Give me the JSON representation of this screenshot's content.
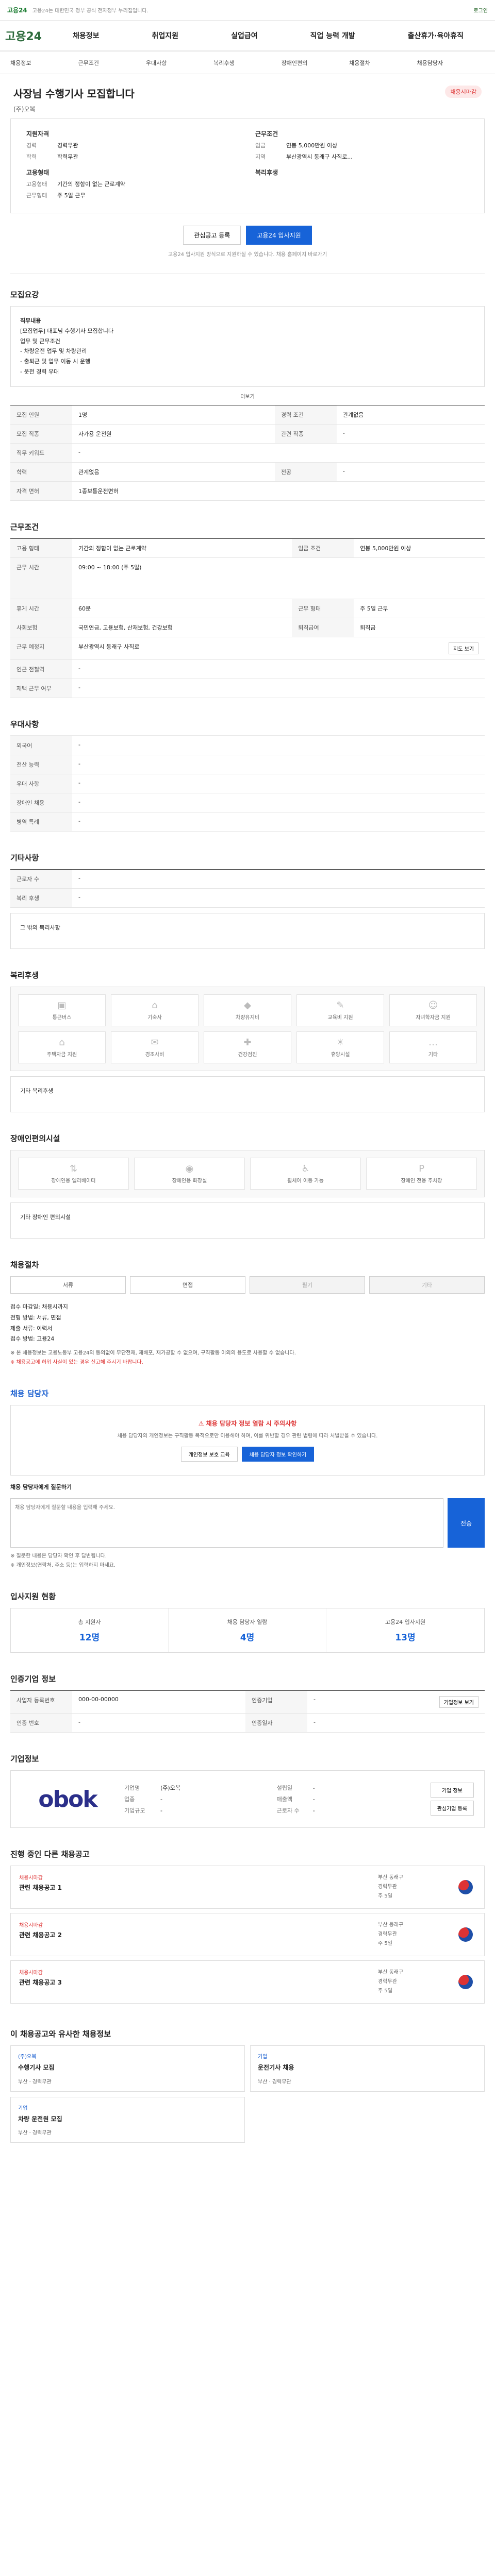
{
  "topbar": {
    "logo": "고용24",
    "notice": "고용24는 대한민국 정부 공식 전자정부 누리집입니다.",
    "right": "로그인"
  },
  "nav": {
    "brand": "고용24",
    "menu": [
      "채용정보",
      "취업지원",
      "실업급여",
      "직업 능력 개발",
      "출산휴가·육아휴직"
    ]
  },
  "subnav": [
    "채용정보",
    "근무조건",
    "우대사항",
    "복리후생",
    "장애인편의",
    "채용절차",
    "채용담당자"
  ],
  "posting": {
    "title": "사장님 수행기사 모집합니다",
    "badge": "채용시마감",
    "company": "(주)오복",
    "left_head": "지원자격",
    "right_head": "근무조건",
    "left_rows": [
      {
        "k": "경력",
        "v": "경력무관"
      },
      {
        "k": "학력",
        "v": "학력무관"
      }
    ],
    "right_rows": [
      {
        "k": "임금",
        "v": "연봉 5,000만원 이상"
      },
      {
        "k": "지역",
        "v": "부산광역시 동래구 사직로..."
      }
    ],
    "left_head2": "고용형태",
    "right_head2": "복리후생",
    "left_rows2": [
      {
        "k": "고용형태",
        "v": "기간의 정함이 없는 근로계약"
      },
      {
        "k": "근무형태",
        "v": "주 5일 근무"
      }
    ],
    "btn_scrap": "관심공고 등록",
    "btn_apply": "고용24 입사지원",
    "note": "고용24 입사지원 방식으로 지원하실 수 있습니다. 채용 홈페이지 바로가기"
  },
  "sections": {
    "recruit": "모집요강",
    "work": "근무조건",
    "pref": "우대사항",
    "etc": "기타사항",
    "welfare": "복리후생",
    "disabled": "장애인편의시설",
    "process": "채용절차",
    "contact": "채용 담당자",
    "stats": "입사지원 현황",
    "gov_info": "인증기업 정보",
    "company_info": "기업정보",
    "jobs": "진행 중인 다른 채용공고",
    "related": "이 채용공고와 유사한 채용정보"
  },
  "recruit": {
    "box_title": "직무내용",
    "box_lines": [
      "[모집업무] 대표님 수행기사 모집합니다",
      "업무 및 근무조건",
      "- 차량운전 업무 및 차량관리",
      "- 출퇴근 및 업무 이동 시 운행",
      "- 운전 경력 우대"
    ],
    "rows": [
      {
        "k": "모집 인원",
        "v": "1명",
        "k2": "경력 조건",
        "v2": "관계없음"
      },
      {
        "k": "모집 직종",
        "v": "자가용 운전원",
        "k2": "관련 직종",
        "v2": "-"
      },
      {
        "k": "직무 키워드",
        "v": "-",
        "k2": "",
        "v2": ""
      },
      {
        "k": "학력",
        "v": "관계없음",
        "k2": "전공",
        "v2": "-"
      },
      {
        "k": "자격 면허",
        "v": "1종보통운전면허",
        "k2": "",
        "v2": ""
      }
    ],
    "more": "더보기"
  },
  "work": {
    "rows": [
      {
        "k": "고용 형태",
        "v": "기간의 정함이 없는 근로계약",
        "k2": "임금 조건",
        "v2": "연봉 5,000만원 이상"
      },
      {
        "k": "근무 시간",
        "v": "09:00 ~ 18:00 (주 5일)",
        "k2": "",
        "v2": ""
      },
      {
        "k": "휴게 시간",
        "v": "60분",
        "k2": "근무 형태",
        "v2": "주 5일 근무"
      },
      {
        "k": "사회보험",
        "v": "국민연금, 고용보험, 산재보험, 건강보험",
        "k2": "퇴직급여",
        "v2": "퇴직금"
      },
      {
        "k": "근무 예정지",
        "v": "부산광역시 동래구 사직로",
        "k2": "",
        "v2": ""
      },
      {
        "k": "인근 전철역",
        "v": "-",
        "k2": "",
        "v2": ""
      },
      {
        "k": "재택 근무 여부",
        "v": "-",
        "k2": "",
        "v2": ""
      }
    ],
    "map_btn": "지도 보기"
  },
  "pref": {
    "rows": [
      {
        "k": "외국어",
        "v": "-"
      },
      {
        "k": "전산 능력",
        "v": "-"
      },
      {
        "k": "우대 사항",
        "v": "-"
      },
      {
        "k": "장애인 채용",
        "v": "-"
      },
      {
        "k": "병역 특례",
        "v": "-"
      }
    ]
  },
  "etc": {
    "rows": [
      {
        "k": "근로자 수",
        "v": "-"
      },
      {
        "k": "복리 후생",
        "v": "-"
      }
    ],
    "box": "그 밖의 복리사항"
  },
  "welfare": {
    "items": [
      "통근버스",
      "기숙사",
      "차량유지비",
      "교육비 지원",
      "자녀학자금 지원",
      "주택자금 지원",
      "경조사비",
      "건강검진",
      "휴양시설",
      "기타"
    ],
    "box": "기타 복리후생"
  },
  "disabled": {
    "items": [
      "장애인용 엘리베이터",
      "장애인용 화장실",
      "휠체어 이동 가능",
      "장애인 전용 주차장"
    ],
    "box": "기타 장애인 편의시설"
  },
  "process": {
    "tabs": [
      "서류",
      "면접",
      "필기",
      "기타"
    ],
    "lines": [
      "접수 마감일: 채용시까지",
      "전형 방법: 서류, 면접",
      "제출 서류: 이력서",
      "접수 방법: 고용24"
    ],
    "warn1": "※ 본 채용정보는 고용노동부 고용24의 동의없이 무단전재, 재배포, 재가공할 수 없으며, 구직활동 이외의 용도로 사용할 수 없습니다.",
    "warn2": "※ 채용공고에 허위 사실이 있는 경우 신고해 주시기 바랍니다."
  },
  "contact": {
    "alert": "채용 담당자 정보 열람 시 주의사항",
    "p": "채용 담당자의 개인정보는 구직활동 목적으로만 이용해야 하며, 이를 위반할 경우 관련 법령에 따라 처벌받을 수 있습니다.",
    "btn1": "개인정보 보호 교육",
    "btn2": "채용 담당자 정보 확인하기",
    "inq_label": "채용 담당자에게 질문하기",
    "inq_placeholder": "채용 담당자에게 질문할 내용을 입력해 주세요.",
    "send": "전송",
    "notes": [
      "※ 질문한 내용은 담당자 확인 후 답변됩니다.",
      "※ 개인정보(연락처, 주소 등)는 입력하지 마세요."
    ]
  },
  "stats": [
    {
      "l": "총 지원자",
      "n": "12명"
    },
    {
      "l": "채용 담당자 열람",
      "n": "4명"
    },
    {
      "l": "고용24 입사지원",
      "n": "13명"
    }
  ],
  "gov_info": {
    "rows": [
      {
        "k": "사업자 등록번호",
        "v": "000-00-00000",
        "k2": "인증기업",
        "v2": "-"
      },
      {
        "k": "인증 번호",
        "v": "-",
        "k2": "인증일자",
        "v2": "-"
      }
    ],
    "btn": "기업정보 보기"
  },
  "company_info": {
    "logo": "obok",
    "rows": [
      {
        "k": "기업명",
        "v": "(주)오복"
      },
      {
        "k": "설립일",
        "v": "-"
      },
      {
        "k": "업종",
        "v": "-"
      },
      {
        "k": "매출액",
        "v": "-"
      },
      {
        "k": "기업규모",
        "v": "-"
      },
      {
        "k": "근로자 수",
        "v": "-"
      }
    ],
    "btn1": "기업 정보",
    "btn2": "관심기업 등록"
  },
  "jobs": [
    {
      "tag": "채용시마감",
      "name": "관련 채용공고 1",
      "meta": [
        "부산 동래구",
        "경력무관",
        "주 5일"
      ]
    },
    {
      "tag": "채용시마감",
      "name": "관련 채용공고 2",
      "meta": [
        "부산 동래구",
        "경력무관",
        "주 5일"
      ]
    },
    {
      "tag": "채용시마감",
      "name": "관련 채용공고 3",
      "meta": [
        "부산 동래구",
        "경력무관",
        "주 5일"
      ]
    }
  ],
  "related": [
    {
      "c": "(주)오복",
      "t": "수행기사 모집",
      "m": "부산 · 경력무관"
    },
    {
      "c": "기업",
      "t": "운전기사 채용",
      "m": "부산 · 경력무관"
    },
    {
      "c": "기업",
      "t": "차량 운전원 모집",
      "m": "부산 · 경력무관"
    }
  ]
}
